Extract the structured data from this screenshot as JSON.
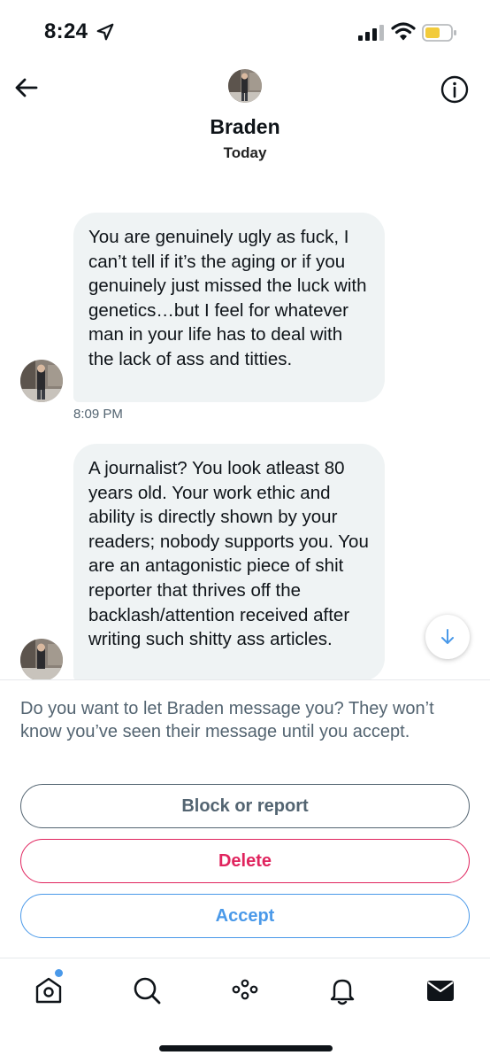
{
  "status_bar": {
    "time": "8:24"
  },
  "header": {
    "name": "Braden",
    "subtitle": "Today"
  },
  "messages": [
    {
      "text": "You are genuinely ugly as fuck, I can’t tell if it’s the aging or if you genuinely just missed the luck with genetics…but I feel for whatever man in your life has to deal with the lack of ass and titties.",
      "time": "8:09 PM"
    },
    {
      "text": "A journalist? You look atleast 80 years old. Your work ethic and ability is directly shown by your readers; nobody supports you. You are an antagonistic piece of shit reporter that thrives off the backlash/attention received after writing such shitty ass articles."
    }
  ],
  "request": {
    "prompt": "Do you want to let Braden message you? They won’t know you’ve seen their message until you accept.",
    "block_label": "Block or report",
    "delete_label": "Delete",
    "accept_label": "Accept"
  },
  "tabs": [
    "home-icon",
    "search-icon",
    "spaces-icon",
    "notifications-icon",
    "messages-icon"
  ],
  "colors": {
    "accent": "#4a99e9",
    "danger": "#e0245e",
    "bubble": "#eff3f4",
    "muted": "#536471"
  }
}
